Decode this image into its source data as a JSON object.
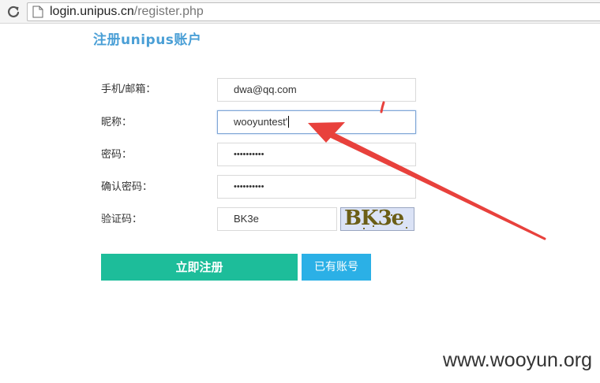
{
  "browser": {
    "url_host": "login.unipus.cn",
    "url_path": "/register.php"
  },
  "form": {
    "title": "注册unipus账户",
    "fields": [
      {
        "label": "手机/邮箱：",
        "value": "dwa@qq.com"
      },
      {
        "label": "昵称：",
        "value": "wooyuntest'"
      },
      {
        "label": "密码：",
        "value": "••••••••••"
      },
      {
        "label": "确认密码：",
        "value": "••••••••••"
      },
      {
        "label": "验证码：",
        "value": "BK3e"
      }
    ],
    "captcha_text": "BK3e",
    "submit_label": "立即注册",
    "login_label": "已有账号"
  },
  "annotation": {
    "arrow_color": "#e8413c"
  },
  "watermark": "www.wooyun.org"
}
